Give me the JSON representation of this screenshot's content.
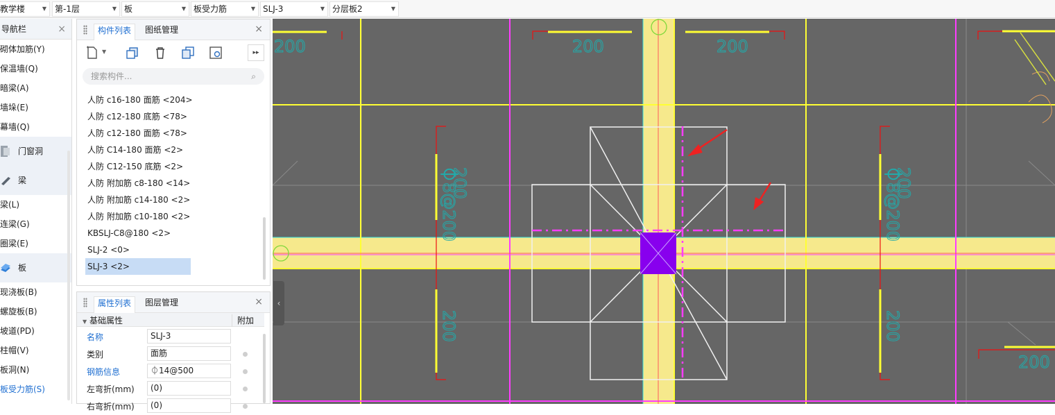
{
  "toolbar": {
    "dropdowns": [
      {
        "label": "教学楼"
      },
      {
        "label": "第-1层"
      },
      {
        "label": "板"
      },
      {
        "label": "板受力筋"
      },
      {
        "label": "SLJ-3"
      },
      {
        "label": "分层板2"
      }
    ]
  },
  "nav": {
    "title": "导航栏",
    "close": "×",
    "items": [
      "砌体加筋(Y)",
      "保温墙(Q)",
      "暗梁(A)",
      "墙垛(E)",
      "幕墙(Q)"
    ],
    "group_door": "门窗洞",
    "group_beam": "梁",
    "beam_items": [
      "梁(L)",
      "连梁(G)",
      "圈梁(E)"
    ],
    "group_slab": "板",
    "slab_items": [
      "现浇板(B)",
      "螺旋板(B)",
      "坡道(PD)",
      "柱帽(V)",
      "板洞(N)",
      "板受力筋(S)"
    ]
  },
  "components": {
    "tab_active": "构件列表",
    "tab_other": "图纸管理",
    "close": "×",
    "search_placeholder": "搜索构件...",
    "items": [
      "人防 c16-180 面筋 <204>",
      "人防 c12-180 底筋 <78>",
      "人防 c12-180 面筋 <78>",
      "人防 C14-180 面筋 <2>",
      "人防 C12-150 底筋 <2>",
      "人防 附加筋 c8-180 <14>",
      "人防 附加筋 c14-180 <2>",
      "人防 附加筋 c10-180 <2>",
      "KBSLJ-C8@180 <2>",
      "SLJ-2 <0>",
      "SLJ-3 <2>"
    ],
    "selected_index": 10
  },
  "properties": {
    "tab_active": "属性列表",
    "tab_other": "图层管理",
    "close": "×",
    "group_title": "基础属性",
    "extra_header": "附加",
    "rows": [
      {
        "key": "名称",
        "value": "SLJ-3"
      },
      {
        "key": "类别",
        "value": "面筋"
      },
      {
        "key": "钢筋信息",
        "value": "⏀14@500"
      },
      {
        "key": "左弯折(mm)",
        "value": "(0)"
      },
      {
        "key": "右弯折(mm)",
        "value": "(0)"
      }
    ]
  },
  "canvas": {
    "labels": {
      "dim_200": "200",
      "rebar_vertical": "8@200",
      "rebar_vertical_full": "⏀8@200"
    },
    "colors": {
      "background": "#666666",
      "column_band": "#f6e98c",
      "axis_magenta": "#ff3cff",
      "grid_yellow": "#ffff33",
      "purple_column": "#8800ee",
      "arrow_red": "#ee2222",
      "dim_cyan": "#22aaaa"
    }
  }
}
